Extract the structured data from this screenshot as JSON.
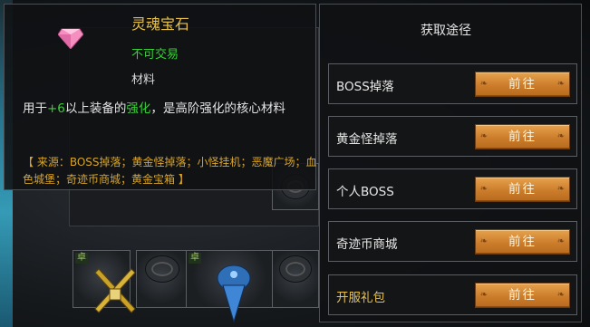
{
  "item": {
    "name": "灵魂宝石",
    "trade_status": "不可交易",
    "category": "材料",
    "desc_pre": "用于",
    "desc_plus": "+6",
    "desc_mid": "以上装备的",
    "desc_strengthen": "强化",
    "desc_post": "，是高阶强化的核心材料",
    "source": "【 来源：BOSS掉落；黄金怪掉落；小怪挂机；恶魔广场；血色城堡；奇迹币商城；黄金宝箱 】"
  },
  "slots": {
    "tag": "卓"
  },
  "acquire": {
    "title": "获取途径",
    "routes": [
      {
        "label": "BOSS掉落",
        "button": "前往"
      },
      {
        "label": "黄金怪掉落",
        "button": "前往"
      },
      {
        "label": "个人BOSS",
        "button": "前往"
      },
      {
        "label": "奇迹币商城",
        "button": "前往"
      },
      {
        "label": "开服礼包",
        "button": "前往"
      }
    ]
  },
  "colors": {
    "title_gold": "#e8c24a",
    "trade_green": "#38d038",
    "source_orange": "#d8a428",
    "button_orange": "#cc7d2b"
  }
}
